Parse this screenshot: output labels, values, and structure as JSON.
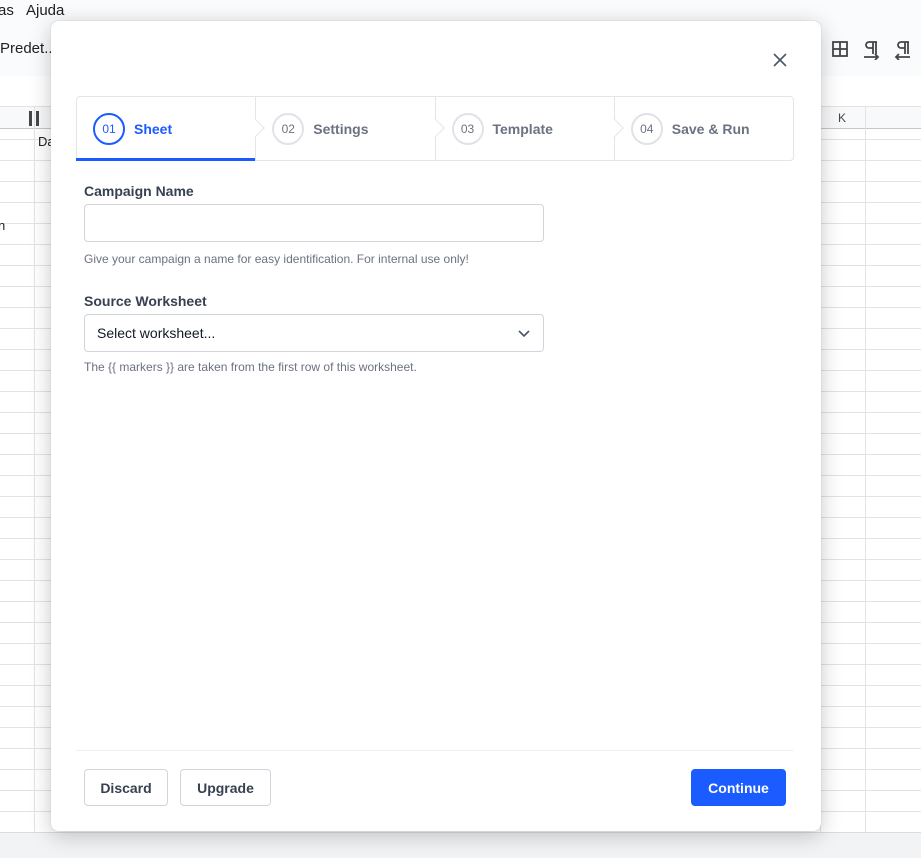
{
  "background": {
    "menu": [
      "as",
      "Ajuda"
    ],
    "font_select": "Predet...",
    "toolbar_icons": [
      "table-icon",
      "text-direction-ltr-icon",
      "text-direction-rtl-icon"
    ],
    "column_header": "K",
    "cells": [
      "Da",
      "n"
    ]
  },
  "dialog": {
    "steps": [
      {
        "num": "01",
        "label": "Sheet",
        "active": true
      },
      {
        "num": "02",
        "label": "Settings",
        "active": false
      },
      {
        "num": "03",
        "label": "Template",
        "active": false
      },
      {
        "num": "04",
        "label": "Save & Run",
        "active": false
      }
    ],
    "campaign": {
      "label": "Campaign Name",
      "value": "",
      "placeholder": "",
      "help": "Give your campaign a name for easy identification. For internal use only!"
    },
    "worksheet": {
      "label": "Source Worksheet",
      "selected": "Select worksheet...",
      "help": "The {{ markers }} are taken from the first row of this worksheet."
    },
    "buttons": {
      "discard": "Discard",
      "upgrade": "Upgrade",
      "continue": "Continue"
    },
    "colors": {
      "accent": "#1a5cff",
      "muted": "#6b7280",
      "border": "#d1d5db"
    }
  }
}
